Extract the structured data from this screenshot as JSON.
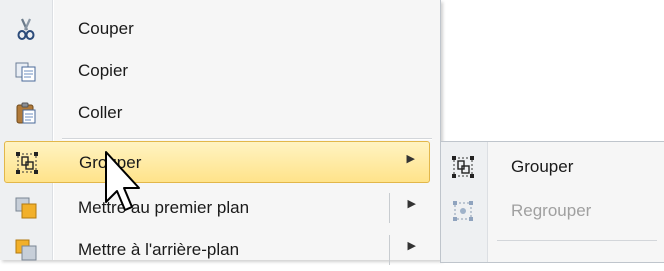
{
  "menu": {
    "items": [
      {
        "label": "Couper",
        "icon": "scissors-icon"
      },
      {
        "label": "Copier",
        "icon": "copy-icon"
      },
      {
        "label": "Coller",
        "icon": "paste-icon"
      },
      {
        "label": "Grouper",
        "icon": "group-icon",
        "has_submenu": true,
        "highlighted": true
      },
      {
        "label": "Mettre au premier plan",
        "icon": "bring-forward-icon",
        "has_submenu": true
      },
      {
        "label": "Mettre à l'arrière-plan",
        "icon": "send-backward-icon",
        "has_submenu": true
      }
    ],
    "submenu_arrow": "▶"
  },
  "submenu": {
    "items": [
      {
        "label": "Grouper",
        "icon": "group-icon",
        "enabled": true
      },
      {
        "label": "Regrouper",
        "icon": "regroup-icon",
        "enabled": false
      }
    ]
  },
  "colors": {
    "highlight_top": "#fff3c2",
    "highlight_bottom": "#ffe38a",
    "highlight_border": "#e2b74a",
    "disabled_text": "#a0a0a0"
  }
}
